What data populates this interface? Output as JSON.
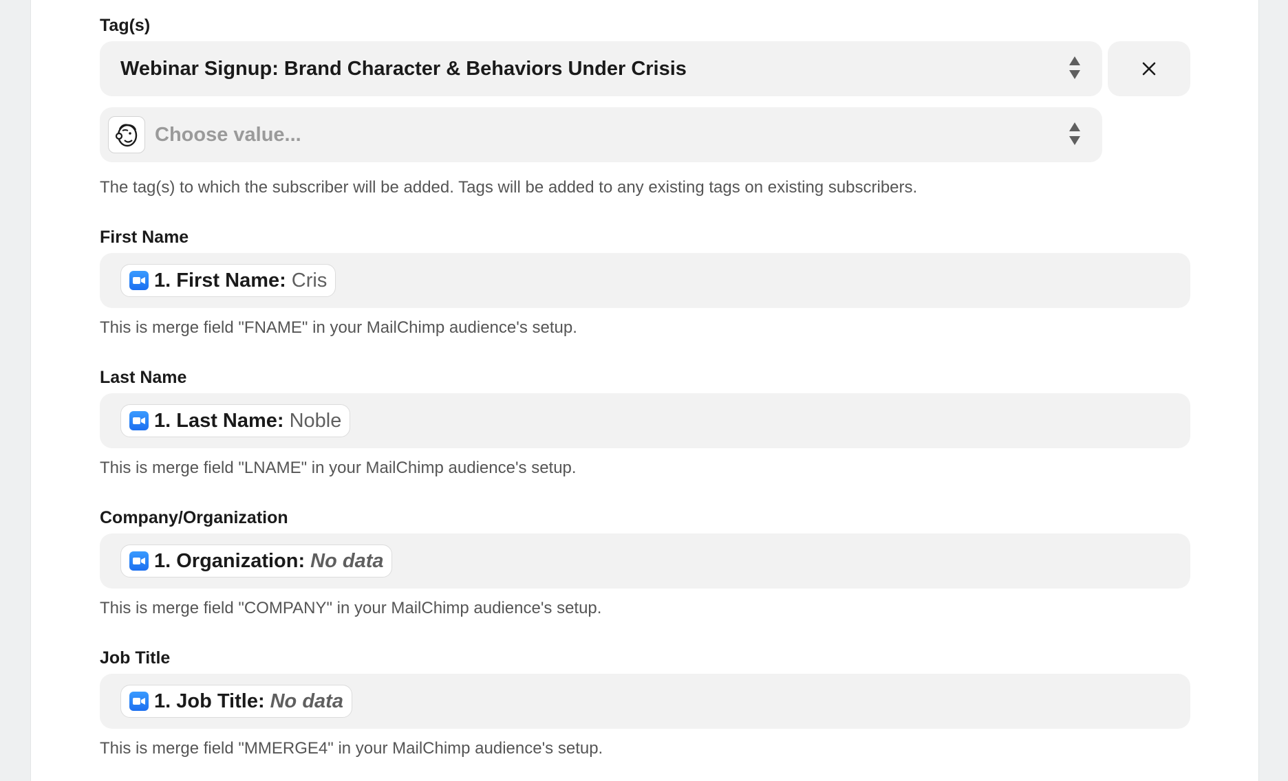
{
  "tags": {
    "label": "Tag(s)",
    "selected_value": "Webinar Signup: Brand Character & Behaviors Under Crisis",
    "clear_icon": "close-icon",
    "choose_placeholder": "Choose value...",
    "app_icon": "mailchimp-icon",
    "help": "The tag(s) to which the subscriber will be added. Tags will be added to any existing tags on existing subscribers."
  },
  "fields": [
    {
      "label": "First Name",
      "pill_key": "1. First Name:",
      "pill_value": "Cris",
      "no_data": false,
      "help": "This is merge field \"FNAME\" in your MailChimp audience's setup."
    },
    {
      "label": "Last Name",
      "pill_key": "1. Last Name:",
      "pill_value": "Noble",
      "no_data": false,
      "help": "This is merge field \"LNAME\" in your MailChimp audience's setup."
    },
    {
      "label": "Company/Organization",
      "pill_key": "1. Organization:",
      "pill_value": "No data",
      "no_data": true,
      "help": "This is merge field \"COMPANY\" in your MailChimp audience's setup."
    },
    {
      "label": "Job Title",
      "pill_key": "1. Job Title:",
      "pill_value": "No data",
      "no_data": true,
      "help": "This is merge field \"MMERGE4\" in your MailChimp audience's setup."
    }
  ],
  "colors": {
    "field_bg": "#f2f2f2",
    "page_bg": "#eef0f1",
    "zoom_blue": "#1c6ff0"
  }
}
